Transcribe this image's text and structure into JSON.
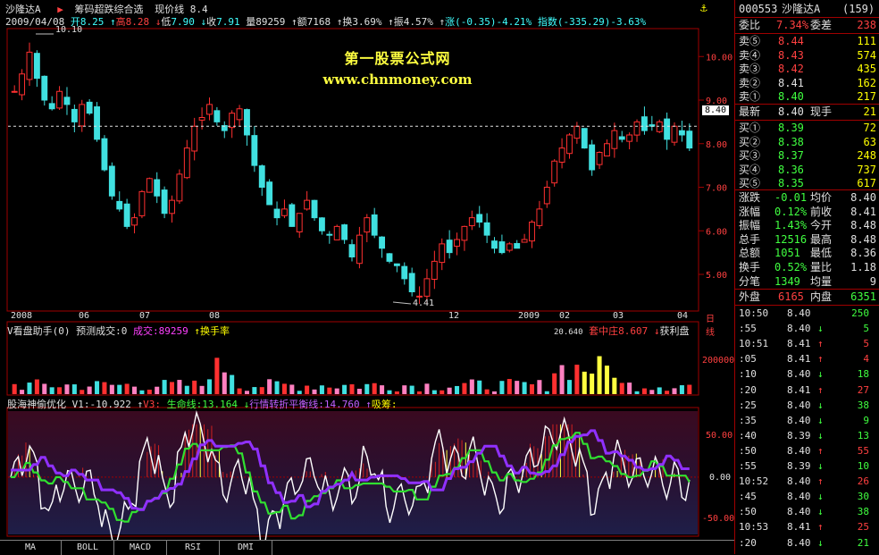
{
  "header": {
    "stock_name": "沙隆达A",
    "formula_name": "筹码超跌综合选",
    "current_label": "现价线 8.4",
    "date": "2009/04/08",
    "open_label": "开",
    "open": "8.25",
    "high_label": "高",
    "high": "8.28",
    "low_label": "低",
    "low": "7.90",
    "close_label": "收",
    "close": "7.91",
    "volume_label": "量",
    "volume": "89259",
    "amount_label": "额",
    "amount": "7168",
    "turnover_label": "换",
    "turnover": "3.69%",
    "amplitude_label": "振",
    "amplitude": "4.57%",
    "change_label": "涨",
    "change": "(-0.35)-4.21%",
    "index_label": "指数",
    "index": "(-335.29)-3.63%"
  },
  "watermark": {
    "title": "第一股票公式网",
    "url": "www.chnmoney.com"
  },
  "price_panel": {
    "y_ticks": [
      "10.00",
      "9.00",
      "8.00",
      "7.00",
      "6.00",
      "5.00"
    ],
    "high_marker": "10.10",
    "low_marker": "4.41",
    "last_price_tag": "8.40",
    "x_labels": [
      "2008",
      "06",
      "07",
      "08",
      "12",
      "2009",
      "02",
      "03",
      "04"
    ],
    "period_label": "日线"
  },
  "volume_panel": {
    "title": "V看盘助手(0) 预测成交:0",
    "vol_label": "成交:89259",
    "turn_label": "换手率",
    "cut_text": "20.640",
    "signal_label": "套中庄",
    "signal_value": "8.607",
    "profit_label": "获利盘",
    "y_tick": "200000"
  },
  "indicator_panel": {
    "name": "股海神偷优化",
    "v1": "V1:-10.922",
    "v3": "V3:",
    "life_label": "生命线:13.164",
    "trend_label": "行情转折平衡线:14.760",
    "absorb_label": "吸筹:",
    "y_ticks": [
      "50.00",
      "0.00",
      "-50.00"
    ]
  },
  "tabs": [
    "MA",
    "BOLL",
    "MACD",
    "RSI",
    "DMI"
  ],
  "quote": {
    "code": "000553",
    "name": "沙隆达A",
    "count": "(159)",
    "wb_label": "委比",
    "wb_value": "7.34%",
    "wc_label": "委差",
    "wc_value": "238",
    "asks": [
      {
        "label": "卖⑤",
        "price": "8.44",
        "vol": "111"
      },
      {
        "label": "卖④",
        "price": "8.43",
        "vol": "574"
      },
      {
        "label": "卖③",
        "price": "8.42",
        "vol": "435"
      },
      {
        "label": "卖②",
        "price": "8.41",
        "vol": "162"
      },
      {
        "label": "卖①",
        "price": "8.40",
        "vol": "217"
      }
    ],
    "last_label": "最新",
    "last_value": "8.40",
    "now_label": "现手",
    "now_value": "21",
    "bids": [
      {
        "label": "买①",
        "price": "8.39",
        "vol": "72"
      },
      {
        "label": "买②",
        "price": "8.38",
        "vol": "63"
      },
      {
        "label": "买③",
        "price": "8.37",
        "vol": "248"
      },
      {
        "label": "买④",
        "price": "8.36",
        "vol": "737"
      },
      {
        "label": "买⑤",
        "price": "8.35",
        "vol": "617"
      }
    ],
    "stats": [
      {
        "l1": "涨跌",
        "v1": "-0.01",
        "l2": "均价",
        "v2": "8.40"
      },
      {
        "l1": "涨幅",
        "v1": "0.12%",
        "l2": "前收",
        "v2": "8.41"
      },
      {
        "l1": "振幅",
        "v1": "1.43%",
        "l2": "今开",
        "v2": "8.48"
      },
      {
        "l1": "总手",
        "v1": "12516",
        "l2": "最高",
        "v2": "8.48"
      },
      {
        "l1": "总额",
        "v1": "1051",
        "l2": "最低",
        "v2": "8.36"
      },
      {
        "l1": "换手",
        "v1": "0.52%",
        "l2": "量比",
        "v2": "1.18"
      },
      {
        "l1": "分笔",
        "v1": "1349",
        "l2": "均量",
        "v2": "9"
      }
    ],
    "outer_label": "外盘",
    "outer_value": "6165",
    "inner_label": "内盘",
    "inner_value": "6351",
    "ticks": [
      {
        "t": "10:50",
        "p": "8.40",
        "a": "",
        "v": "250"
      },
      {
        "t": ":55",
        "p": "8.40",
        "a": "↓",
        "v": "5"
      },
      {
        "t": "10:51",
        "p": "8.41",
        "a": "↑",
        "v": "5"
      },
      {
        "t": ":05",
        "p": "8.41",
        "a": "↑",
        "v": "4"
      },
      {
        "t": ":10",
        "p": "8.40",
        "a": "↓",
        "v": "18"
      },
      {
        "t": ":20",
        "p": "8.41",
        "a": "↑",
        "v": "27"
      },
      {
        "t": ":25",
        "p": "8.40",
        "a": "↓",
        "v": "38"
      },
      {
        "t": ":35",
        "p": "8.40",
        "a": "↓",
        "v": "9"
      },
      {
        "t": ":40",
        "p": "8.39",
        "a": "↓",
        "v": "13"
      },
      {
        "t": ":50",
        "p": "8.40",
        "a": "↑",
        "v": "55"
      },
      {
        "t": ":55",
        "p": "8.39",
        "a": "↓",
        "v": "10"
      },
      {
        "t": "10:52",
        "p": "8.40",
        "a": "↑",
        "v": "26"
      },
      {
        "t": ":45",
        "p": "8.40",
        "a": "↓",
        "v": "30"
      },
      {
        "t": ":50",
        "p": "8.40",
        "a": "↓",
        "v": "38"
      },
      {
        "t": "10:53",
        "p": "8.41",
        "a": "↑",
        "v": "25"
      },
      {
        "t": ":20",
        "p": "8.40",
        "a": "↓",
        "v": "21"
      }
    ]
  },
  "chart_data": {
    "type": "candlestick",
    "title": "沙隆达A",
    "ylim": [
      4.2,
      10.6
    ],
    "x_labels": [
      "2008",
      "06",
      "07",
      "08",
      "12",
      "2009",
      "02",
      "03",
      "04"
    ],
    "closes": [
      9.2,
      9.6,
      10.1,
      9.5,
      9.0,
      8.8,
      9.2,
      8.9,
      8.5,
      8.9,
      8.7,
      8.1,
      7.4,
      6.8,
      6.5,
      6.1,
      6.3,
      6.9,
      7.2,
      6.8,
      6.4,
      6.7,
      7.3,
      7.9,
      8.4,
      8.6,
      8.9,
      8.5,
      8.3,
      8.7,
      8.8,
      8.2,
      7.5,
      7.0,
      6.6,
      6.3,
      6.5,
      6.1,
      6.4,
      6.7,
      6.3,
      6.0,
      5.9,
      6.1,
      5.8,
      5.4,
      5.9,
      6.3,
      5.9,
      5.6,
      5.3,
      5.2,
      4.9,
      4.6,
      4.5,
      4.9,
      5.3,
      5.7,
      5.5,
      5.8,
      6.1,
      6.3,
      6.2,
      5.9,
      5.6,
      5.5,
      5.7,
      5.6,
      5.8,
      6.2,
      6.5,
      7.0,
      7.6,
      7.9,
      8.2,
      8.4,
      7.9,
      7.4,
      7.8,
      8.0,
      8.3,
      8.1,
      8.2,
      8.5,
      8.3,
      8.4,
      8.5,
      8.1,
      8.4,
      8.2,
      7.9
    ],
    "volume_scale_tick": 200000,
    "indicator": {
      "name": "股海神偷优化",
      "V1": -10.922,
      "life_line": 13.164,
      "balance_line": 14.76,
      "ylim": [
        -65,
        75
      ]
    },
    "grid": false,
    "legend": "top-left"
  }
}
